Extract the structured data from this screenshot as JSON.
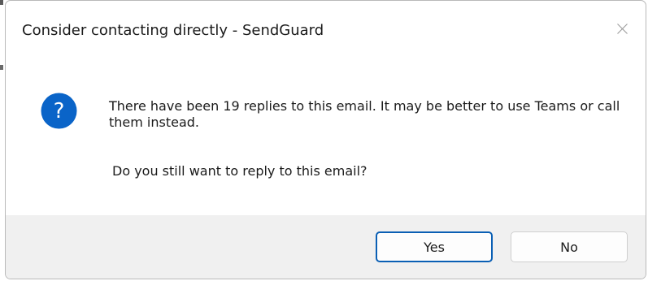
{
  "dialog": {
    "title": "Consider contacting directly - SendGuard",
    "message": "There have been 19 replies to this email. It may be better to use Teams or call them instead.",
    "prompt": "Do you still want to reply to this email?",
    "icon": "question-icon",
    "close_icon": "close-icon"
  },
  "buttons": {
    "yes_label": "Yes",
    "no_label": "No"
  },
  "colors": {
    "icon_blue": "#0a64c8",
    "default_button_border": "#0a5fb4",
    "footer_background": "#f0f0f0"
  }
}
